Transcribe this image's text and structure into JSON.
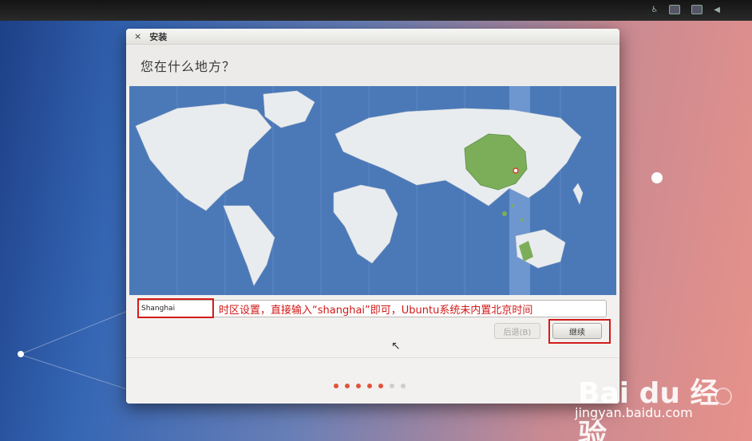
{
  "window": {
    "title": "安装",
    "close_glyph": "×"
  },
  "page": {
    "heading": "您在什么地方？"
  },
  "timezone": {
    "value": "Shanghai",
    "annotation": "时区设置，直接输入“shanghai”即可，Ubuntu系统未内置北京时间"
  },
  "buttons": {
    "back": "后退(B)",
    "next": "继续"
  },
  "progress": {
    "total_steps": 7,
    "current_step": 5,
    "active_color": "#e0533a",
    "inactive_color": "#cfcdca"
  },
  "watermark": {
    "logo": "Bai du 经验",
    "site": "jingyan.baidu.com"
  },
  "colors": {
    "highlight_red": "#d41a1a",
    "map_ocean": "#4b79b8",
    "land": "#e9ecef",
    "selected_region": "#7cae5a"
  }
}
